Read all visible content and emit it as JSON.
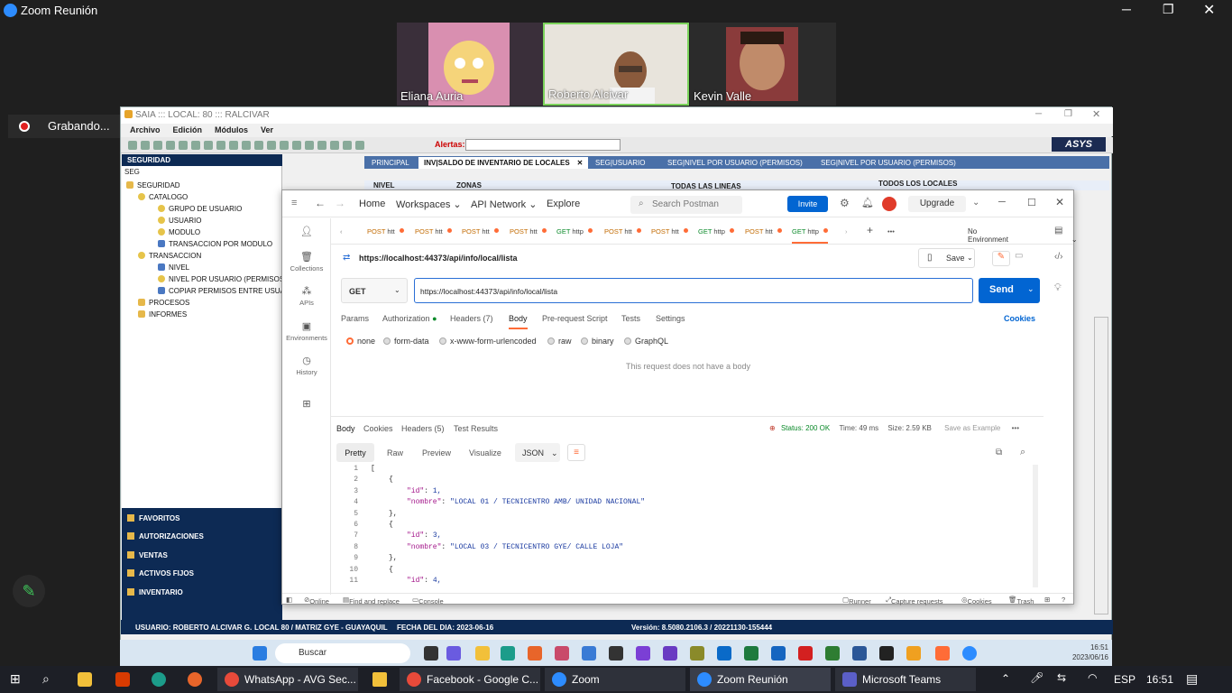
{
  "zoom": {
    "window_title": "Zoom Reunión",
    "participants": [
      {
        "name": "Eliana Auria"
      },
      {
        "name": "Roberto Alcivar"
      },
      {
        "name": "Kevin Valle"
      }
    ],
    "recording_label": "Grabando..."
  },
  "saia": {
    "title": "SAIA ::: LOCAL: 80 ::: RALCIVAR",
    "menu": [
      "Archivo",
      "Edición",
      "Módulos",
      "Ver"
    ],
    "alerts_label": "Alertas:",
    "brand": "ASYS",
    "tree_header": "SEGURIDAD",
    "tree_filter": "SEG",
    "tree": [
      "SEGURIDAD",
      "CATALOGO",
      "GRUPO DE USUARIO",
      "USUARIO",
      "MODULO",
      "TRANSACCION POR MODULO",
      "TRANSACCION",
      "NIVEL",
      "NIVEL POR USUARIO (PERMISOS)",
      "COPIAR PERMISOS ENTRE USUARIOS",
      "PROCESOS",
      "INFORMES"
    ],
    "tabs": [
      "PRINCIPAL",
      "INV|SALDO DE INVENTARIO DE LOCALES",
      "SEG|USUARIO",
      "SEG|NIVEL POR USUARIO (PERMISOS)",
      "SEG|NIVEL POR USUARIO (PERMISOS)"
    ],
    "form_labels": [
      "NIVEL",
      "ZONAS",
      "TODAS LAS LINEAS",
      "TODOS LOS LOCALES"
    ],
    "nav": [
      "FAVORITOS",
      "AUTORIZACIONES",
      "VENTAS",
      "ACTIVOS FIJOS",
      "INVENTARIO"
    ],
    "status": {
      "user": "USUARIO: ROBERTO ALCIVAR G.",
      "local": "LOCAL 80 / MATRIZ GYE - GUAYAQUIL",
      "date": "FECHA DEL DIA: 2023-06-16",
      "version": "Versión: 8.5080.2106.3 / 20221130-155444"
    }
  },
  "postman": {
    "nav": [
      "Home",
      "Workspaces",
      "API Network",
      "Explore"
    ],
    "search_placeholder": "Search Postman",
    "invite": "Invite",
    "upgrade": "Upgrade",
    "sidebar": [
      "Collections",
      "APIs",
      "Environments",
      "History"
    ],
    "request_tabs": [
      {
        "method": "POST",
        "label": "htt"
      },
      {
        "method": "POST",
        "label": "htt"
      },
      {
        "method": "POST",
        "label": "htt"
      },
      {
        "method": "POST",
        "label": "htt"
      },
      {
        "method": "GET",
        "label": "http"
      },
      {
        "method": "POST",
        "label": "htt"
      },
      {
        "method": "POST",
        "label": "htt"
      },
      {
        "method": "GET",
        "label": "http"
      },
      {
        "method": "POST",
        "label": "htt"
      },
      {
        "method": "GET",
        "label": "http"
      }
    ],
    "environment": "No Environment",
    "request_title": "https://localhost:44373/api/info/local/lista",
    "save": "Save",
    "method": "GET",
    "url": "https://localhost:44373/api/info/local/lista",
    "send": "Send",
    "request_subtabs": [
      "Params",
      "Authorization",
      "Headers (7)",
      "Body",
      "Pre-request Script",
      "Tests",
      "Settings"
    ],
    "cookies": "Cookies",
    "body_options": [
      "none",
      "form-data",
      "x-www-form-urlencoded",
      "raw",
      "binary",
      "GraphQL"
    ],
    "no_body": "This request does not have a body",
    "response_tabs": [
      "Body",
      "Cookies",
      "Headers (5)",
      "Test Results"
    ],
    "status_text": "Status: 200 OK",
    "time_text": "Time: 49 ms",
    "size_text": "Size: 2.59 KB",
    "save_example": "Save as Example",
    "view_tabs": [
      "Pretty",
      "Raw",
      "Preview",
      "Visualize"
    ],
    "format": "JSON",
    "code_lines": [
      {
        "n": "1",
        "indent": 0,
        "text": "["
      },
      {
        "n": "2",
        "indent": 1,
        "text": "{"
      },
      {
        "n": "3",
        "indent": 2,
        "key": "\"id\"",
        "val": "1,"
      },
      {
        "n": "4",
        "indent": 2,
        "key": "\"nombre\"",
        "val": "\"LOCAL 01 / TECNICENTRO AMB/ UNIDAD NACIONAL\""
      },
      {
        "n": "5",
        "indent": 1,
        "text": "},"
      },
      {
        "n": "6",
        "indent": 1,
        "text": "{"
      },
      {
        "n": "7",
        "indent": 2,
        "key": "\"id\"",
        "val": "3,"
      },
      {
        "n": "8",
        "indent": 2,
        "key": "\"nombre\"",
        "val": "\"LOCAL 03 / TECNICENTRO GYE/ CALLE LOJA\""
      },
      {
        "n": "9",
        "indent": 1,
        "text": "},"
      },
      {
        "n": "10",
        "indent": 1,
        "text": "{"
      },
      {
        "n": "11",
        "indent": 2,
        "key": "\"id\"",
        "val": "4,"
      }
    ],
    "statusbar": [
      "Online",
      "Find and replace",
      "Console",
      "Runner",
      "Capture requests",
      "Cookies",
      "Trash"
    ]
  },
  "inner_taskbar": {
    "search": "Buscar",
    "time": "16:51",
    "date": "2023/06/16"
  },
  "taskbar": {
    "apps": [
      "WhatsApp - AVG Sec...",
      "Facebook - Google C...",
      "Zoom",
      "Zoom Reunión",
      "Microsoft Teams"
    ],
    "language": "ESP",
    "time": "16:51"
  },
  "colors": {
    "postman_orange": "#ff6c37",
    "postman_blue": "#0265d2",
    "saia_navy": "#0d2a54"
  }
}
